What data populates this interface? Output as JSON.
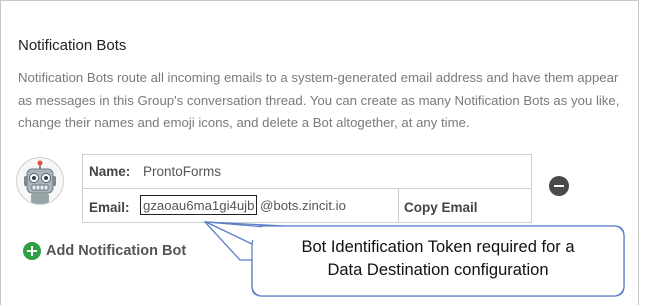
{
  "section": {
    "title": "Notification Bots",
    "description": "Notification Bots route all incoming emails to a system-generated email address and have them appear as messages in this Group's conversation thread. You can create as many Notification Bots as you like, change their names and emoji icons, and delete a Bot altogether, at any time."
  },
  "bot": {
    "avatar_icon": "robot-emoji",
    "name_label": "Name:",
    "name_value": "ProntoForms",
    "email_label": "Email:",
    "email_token": "gzaoau6ma1gi4ujb",
    "email_domain": "@bots.zincit.io",
    "copy_email_label": "Copy Email",
    "remove_icon": "minus-circle-icon"
  },
  "actions": {
    "add_icon": "plus-circle-icon",
    "add_label": "Add Notification Bot",
    "add_color": "#2f9e44"
  },
  "callout": {
    "line1": "Bot Identification Token required for a",
    "line2": "Data Destination configuration",
    "border_color": "#5b7fc7"
  }
}
